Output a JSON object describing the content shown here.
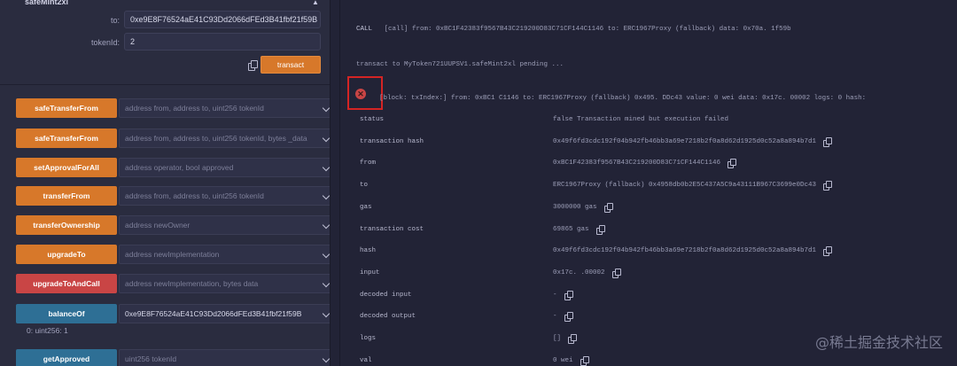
{
  "function_panel": {
    "title": "safeMint2xl",
    "params": [
      {
        "label": "to:",
        "value": "0xe9E8F76524aE41C93Dd2066dFEd3B41fbf21f59B"
      },
      {
        "label": "tokenId:",
        "value": "2"
      }
    ],
    "transact_label": "transact"
  },
  "functions": [
    {
      "label": "safeTransferFrom",
      "color": "#d7782a",
      "field": "address from, address to, uint256 tokenId",
      "has_value": false
    },
    {
      "label": "safeTransferFrom",
      "color": "#d7782a",
      "field": "address from, address to, uint256 tokenId, bytes _data",
      "has_value": false
    },
    {
      "label": "setApprovalForAll",
      "color": "#d7782a",
      "field": "address operator, bool approved",
      "has_value": false
    },
    {
      "label": "transferFrom",
      "color": "#d7782a",
      "field": "address from, address to, uint256 tokenId",
      "has_value": false
    },
    {
      "label": "transferOwnership",
      "color": "#d7782a",
      "field": "address newOwner",
      "has_value": false
    },
    {
      "label": "upgradeTo",
      "color": "#d7782a",
      "field": "address newImplementation",
      "has_value": false
    },
    {
      "label": "upgradeToAndCall",
      "color": "#c94545",
      "field": "address newImplementation, bytes data",
      "has_value": false
    },
    {
      "label": "balanceOf",
      "color": "#2e6f95",
      "field": "0xe9E8F76524aE41C93Dd2066dFEd3B41fbf21f59B",
      "has_value": true
    },
    {
      "label": "getApproved",
      "color": "#2e6f95",
      "field": "uint256 tokenId",
      "has_value": false
    }
  ],
  "balance_result": "0: uint256: 1",
  "terminal": {
    "call_log_label": "CALL",
    "call_log": "[call]  from: 0xBC1F42383f9567B43C219200D83C71CF144C1146 to: ERC1967Proxy (fallback) data: 0x70a.  1f59b",
    "pending": "transact to MyToken721UUPSV1.safeMint2xl pending ...",
    "block_line": "[block: txIndex:]  from: 0xBC1   C1146 to: ERC1967Proxy (fallback) 0x495.  DDc43 value: 0 wei data: 0x17c.   00002 logs: 0 hash:",
    "receipt": [
      {
        "key": "status",
        "value": "false Transaction mined but execution failed",
        "copy": false
      },
      {
        "key": "transaction hash",
        "value": "0x49f6fd3cdc192f04b942fb46bb3a69e7218b2f0a8d62d1925d0c52a8a894b7d1",
        "copy": true
      },
      {
        "key": "from",
        "value": "0xBC1F42383f9567B43C219200D83C71CF144C1146",
        "copy": true
      },
      {
        "key": "to",
        "value": "ERC1967Proxy (fallback) 0x4958db0b2E5C437A5C9a43111B967C3699e0Dc43",
        "copy": true
      },
      {
        "key": "gas",
        "value": "3000000 gas",
        "copy": true
      },
      {
        "key": "transaction cost",
        "value": "69865 gas",
        "copy": true
      },
      {
        "key": "hash",
        "value": "0x49f6fd3cdc192f04b942fb46bb3a69e7218b2f0a8d62d1925d0c52a8a894b7d1",
        "copy": true
      },
      {
        "key": "input",
        "value": "0x17c.  .00002",
        "copy": true
      },
      {
        "key": "decoded input",
        "value": "-",
        "copy": true
      },
      {
        "key": "decoded output",
        "value": " -",
        "copy": true
      },
      {
        "key": "logs",
        "value": "[]",
        "copy": true
      },
      {
        "key": "val",
        "value": "0 wei",
        "copy": true
      }
    ]
  },
  "watermark": "@稀土掘金技术社区"
}
